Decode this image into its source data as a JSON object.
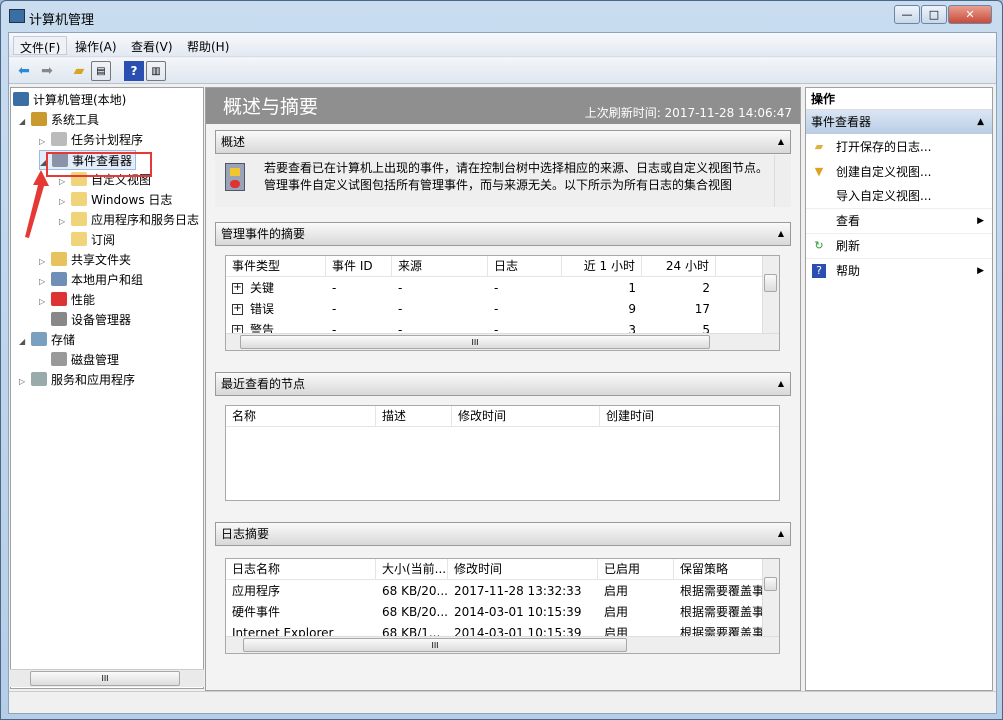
{
  "window": {
    "title": "计算机管理",
    "min": "—",
    "max": "□",
    "close": "✕",
    "close_color": "#c74b3b"
  },
  "menu": [
    "文件(F)",
    "操作(A)",
    "查看(V)",
    "帮助(H)"
  ],
  "toolbar": [
    "back-icon",
    "forward-icon",
    "up-folder-icon",
    "show-hide-tree-icon",
    "help-icon",
    "show-hide-action-pane-icon"
  ],
  "tree": [
    {
      "label": "计算机管理(本地)",
      "level": 0,
      "expander": ""
    },
    {
      "label": "系统工具",
      "level": 1,
      "expander": "expanded"
    },
    {
      "label": "任务计划程序",
      "level": 2,
      "expander": "collapsed"
    },
    {
      "label": "事件查看器",
      "level": 2,
      "expander": "expanded",
      "selected": true,
      "highlight": "#e53935"
    },
    {
      "label": "自定义视图",
      "level": 3,
      "expander": "collapsed"
    },
    {
      "label": "Windows 日志",
      "level": 3,
      "expander": "collapsed"
    },
    {
      "label": "应用程序和服务日志",
      "level": 3,
      "expander": "collapsed"
    },
    {
      "label": "订阅",
      "level": 3,
      "expander": ""
    },
    {
      "label": "共享文件夹",
      "level": 2,
      "expander": "collapsed"
    },
    {
      "label": "本地用户和组",
      "level": 2,
      "expander": "collapsed"
    },
    {
      "label": "性能",
      "level": 2,
      "expander": "collapsed"
    },
    {
      "label": "设备管理器",
      "level": 2,
      "expander": ""
    },
    {
      "label": "存储",
      "level": 1,
      "expander": "expanded"
    },
    {
      "label": "磁盘管理",
      "level": 2,
      "expander": ""
    },
    {
      "label": "服务和应用程序",
      "level": 1,
      "expander": "collapsed"
    }
  ],
  "center": {
    "title": "概述与摘要",
    "refresh": "上次刷新时间: 2017-11-28 14:06:47",
    "overview": {
      "header": "概述",
      "text": "若要查看已在计算机上出现的事件，请在控制台树中选择相应的来源、日志或自定义视图节点。管理事件自定义试图包括所有管理事件，而与来源无关。以下所示为所有日志的集合视图"
    },
    "events": {
      "header": "管理事件的摘要",
      "columns": [
        "事件类型",
        "事件 ID",
        "来源",
        "日志",
        "近 1 小时",
        "24 小时"
      ],
      "rows": [
        [
          "关键",
          "-",
          "-",
          "-",
          "1",
          "2"
        ],
        [
          "错误",
          "-",
          "-",
          "-",
          "9",
          "17"
        ],
        [
          "警告",
          "-",
          "-",
          "-",
          "3",
          "5"
        ]
      ]
    },
    "recent": {
      "header": "最近查看的节点",
      "columns": [
        "名称",
        "描述",
        "修改时间",
        "创建时间"
      ]
    },
    "logs": {
      "header": "日志摘要",
      "columns": [
        "日志名称",
        "大小(当前...",
        "修改时间",
        "已启用",
        "保留策略"
      ],
      "rows": [
        [
          "应用程序",
          "68 KB/20...",
          "2017-11-28 13:32:33",
          "启用",
          "根据需要覆盖事件"
        ],
        [
          "硬件事件",
          "68 KB/20...",
          "2014-03-01 10:15:39",
          "启用",
          "根据需要覆盖事件"
        ],
        [
          "Internet Explorer",
          "68 KB/1...",
          "2014-03-01 10:15:39",
          "启用",
          "根据需要覆盖事件"
        ]
      ]
    }
  },
  "actions": {
    "title": "操作",
    "group": "事件查看器",
    "items": [
      {
        "label": "打开保存的日志...",
        "icon": "open-folder-icon"
      },
      {
        "label": "创建自定义视图...",
        "icon": "filter-icon"
      },
      {
        "label": "导入自定义视图...",
        "icon": ""
      },
      {
        "label": "查看",
        "icon": "",
        "submenu": true
      },
      {
        "label": "刷新",
        "icon": "refresh-icon"
      },
      {
        "label": "帮助",
        "icon": "help-icon",
        "submenu": true
      }
    ]
  }
}
